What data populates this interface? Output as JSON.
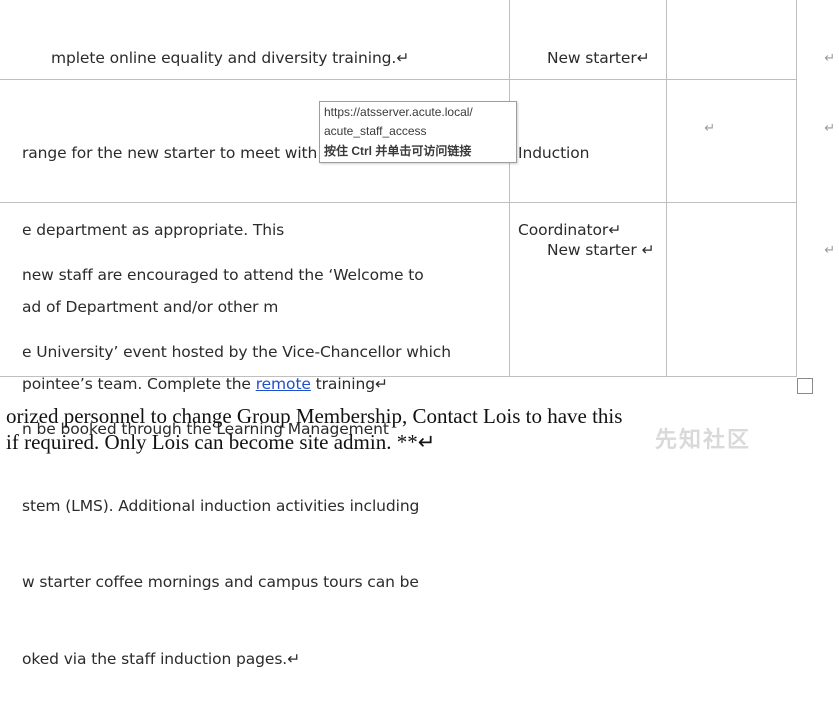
{
  "table": {
    "rows": [
      {
        "lines": [
          "mplete online equality and diversity training.↵"
        ],
        "role": [
          "New starter↵"
        ],
        "col3": "",
        "col4": "↵"
      },
      {
        "lines": [
          "range for the new starter to meet with other staff in",
          "e department as appropriate. This",
          "ad of Department and/or other m",
          "pointee’s team. Complete the "
        ],
        "link_text": "remote",
        "after_link": " training↵",
        "role": [
          "Induction",
          "Coordinator↵"
        ],
        "col3": "↵",
        "col4": "↵"
      },
      {
        "lines": [
          "new staff are encouraged to attend the ‘Welcome to",
          "e University’ event hosted by the Vice-Chancellor which",
          "n be booked through the Learning Management",
          "stem (LMS). Additional induction activities including",
          "w starter coffee mornings and campus tours can be",
          "oked via the staff induction pages.↵"
        ],
        "role": [
          "New starter ↵"
        ],
        "col3": "",
        "col4": "↵"
      }
    ]
  },
  "tooltip": {
    "url_line1": "https://atsserver.acute.local/",
    "url_line2": "acute_staff_access",
    "hint": "按住 Ctrl 并单击可访问链接"
  },
  "paragraph": {
    "line1": "orized personnel to change Group Membership, Contact Lois to have this",
    "line2": "if required. Only Lois can become site admin. **↵"
  },
  "watermark": "先知社区"
}
